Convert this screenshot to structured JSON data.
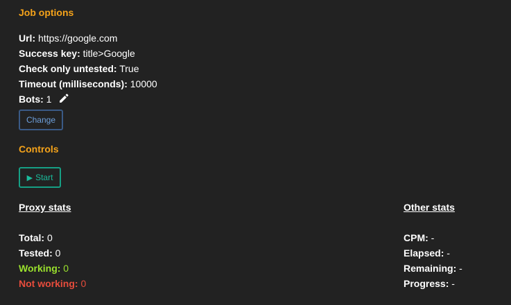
{
  "job": {
    "title": "Job options",
    "url_label": "Url:",
    "url_value": "https://google.com",
    "success_label": "Success key:",
    "success_value": "title>Google",
    "untested_label": "Check only untested:",
    "untested_value": "True",
    "timeout_label": "Timeout (milliseconds):",
    "timeout_value": "10000",
    "bots_label": "Bots:",
    "bots_value": "1",
    "change_label": "Change"
  },
  "controls": {
    "title": "Controls",
    "start_label": "Start"
  },
  "proxy_stats": {
    "title": "Proxy stats",
    "total_label": "Total:",
    "total_value": "0",
    "tested_label": "Tested:",
    "tested_value": "0",
    "working_label": "Working:",
    "working_value": "0",
    "not_working_label": "Not working:",
    "not_working_value": "0"
  },
  "other_stats": {
    "title": "Other stats",
    "cpm_label": "CPM:",
    "cpm_value": "-",
    "elapsed_label": "Elapsed:",
    "elapsed_value": "-",
    "remaining_label": "Remaining:",
    "remaining_value": "-",
    "progress_label": "Progress:",
    "progress_value": "-"
  },
  "colors": {
    "background": "#222222",
    "heading": "#f5a31a",
    "working": "#9be22d",
    "not_working": "#e74c3c",
    "change_button": "#6ea0dc",
    "start_button": "#1abc9c"
  },
  "icons": {
    "bots_edit": "pencil-icon",
    "start": "play-icon"
  }
}
